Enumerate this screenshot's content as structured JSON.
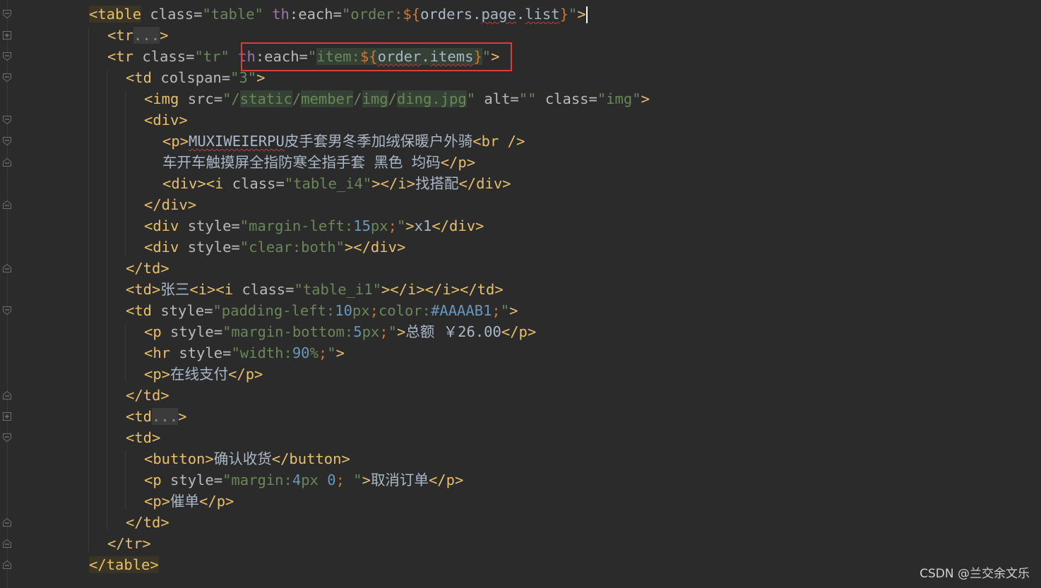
{
  "editor": {
    "lines": [
      {
        "indent": 0,
        "html": "<span class='tag tagbg'>&lt;table</span> <span class='attr'>class=</span><span class='str'>\"table\"</span> <span class='th'>th</span><span class='attr'>:each=</span><span class='str'>\"order:</span><span class='el'>${</span><span class='expr'>orders.<span class='squig'>page</span>.<span class='squig'>list</span></span><span class='el'>}</span><span class='str'>\"</span><span class='tag'>&gt;</span><span class='caret'></span>"
      },
      {
        "indent": 1,
        "html": "<span class='tag'>&lt;tr</span><span class='fold-dots'>...</span><span class='tag'>&gt;</span>"
      },
      {
        "indent": 1,
        "html": "<span class='tag'>&lt;tr</span> <span class='attr'>class=</span><span class='str'>\"tr\"</span> <span class='th'>th</span><span class='attr'>:each=</span><span class='str'>\"</span><span class='str bgstr'>item:</span><span class='el bgstr'>${</span><span class='expr bgstr'><span class='squig'>order</span>.<span class='squig'>items</span></span><span class='el bgstr'>}</span><span class='str'>\"</span><span class='tag'>&gt;</span>"
      },
      {
        "indent": 2,
        "html": "<span class='tag'>&lt;td</span> <span class='attr'>colspan=</span><span class='str'>\"3\"</span><span class='tag'>&gt;</span>"
      },
      {
        "indent": 3,
        "html": "<span class='tag'>&lt;img</span> <span class='attr'>src=</span><span class='str'>\"/<span class='bgstr'>static</span>/<span class='bgstr'>member</span>/<span class='bgstr'>img</span>/<span class='bgstr'>ding.jpg</span>\"</span> <span class='attr'>alt=</span><span class='str'>\"\"</span> <span class='attr'>class=</span><span class='str'>\"img\"</span><span class='tag'>&gt;</span>"
      },
      {
        "indent": 3,
        "html": "<span class='tag'>&lt;div&gt;</span>"
      },
      {
        "indent": 4,
        "html": "<span class='tag'>&lt;p&gt;</span><span class='txt'><span class='squig'>MUXIWEIERPU</span>皮手套男冬季加绒保暖户外骑</span><span class='tag'>&lt;br /&gt;</span>"
      },
      {
        "indent": 4,
        "html": "<span class='txt'>车开车触摸屏全指防寒全指手套 黑色 均码</span><span class='tag'>&lt;/p&gt;</span>"
      },
      {
        "indent": 4,
        "html": "<span class='tag'>&lt;div&gt;&lt;i</span> <span class='attr'>class=</span><span class='str'>\"table_i4\"</span><span class='tag'>&gt;&lt;/i&gt;</span><span class='txt'>找搭配</span><span class='tag'>&lt;/div&gt;</span>"
      },
      {
        "indent": 3,
        "html": "<span class='tag'>&lt;/div&gt;</span>"
      },
      {
        "indent": 3,
        "html": "<span class='tag'>&lt;div</span> <span class='attr'>style=</span><span class='str'>\"margin-left:</span><span class='num'>15</span><span class='str'>px</span><span class='punc'>;</span><span class='str'>\"</span><span class='tag'>&gt;</span><span class='txt'>x1</span><span class='tag'>&lt;/div&gt;</span>"
      },
      {
        "indent": 3,
        "html": "<span class='tag'>&lt;div</span> <span class='attr'>style=</span><span class='str'>\"clear:both\"</span><span class='tag'>&gt;&lt;/div&gt;</span>"
      },
      {
        "indent": 2,
        "html": "<span class='tag'>&lt;/td&gt;</span>"
      },
      {
        "indent": 2,
        "html": "<span class='tag'>&lt;td&gt;</span><span class='txt'>张三</span><span class='tag'>&lt;i&gt;&lt;i</span> <span class='attr'>class=</span><span class='str'>\"table_i1\"</span><span class='tag'>&gt;&lt;/i&gt;&lt;/i&gt;&lt;/td&gt;</span>"
      },
      {
        "indent": 2,
        "html": "<span class='tag'>&lt;td</span> <span class='attr'>style=</span><span class='str'>\"padding-left:</span><span class='num'>10</span><span class='str'>px</span><span class='punc'>;</span><span class='str'>color:</span><span class='num'>#AAAAB1</span><span class='punc'>;</span><span class='str'>\"</span><span class='tag'>&gt;</span>"
      },
      {
        "indent": 3,
        "html": "<span class='tag'>&lt;p</span> <span class='attr'>style=</span><span class='str'>\"margin-bottom:</span><span class='num'>5</span><span class='str'>px</span><span class='punc'>;</span><span class='str'>\"</span><span class='tag'>&gt;</span><span class='txt'>总额 ￥26.00</span><span class='tag'>&lt;/p&gt;</span>"
      },
      {
        "indent": 3,
        "html": "<span class='tag'>&lt;hr</span> <span class='attr'>style=</span><span class='str'>\"width:</span><span class='num'>90</span><span class='str'>%</span><span class='punc'>;</span><span class='str'>\"</span><span class='tag'>&gt;</span>"
      },
      {
        "indent": 3,
        "html": "<span class='tag'>&lt;p&gt;</span><span class='txt'>在线支付</span><span class='tag'>&lt;/p&gt;</span>"
      },
      {
        "indent": 2,
        "html": "<span class='tag'>&lt;/td&gt;</span>"
      },
      {
        "indent": 2,
        "html": "<span class='tag'>&lt;td</span><span class='fold-dots'>...</span><span class='tag'>&gt;</span>"
      },
      {
        "indent": 2,
        "html": "<span class='tag'>&lt;td&gt;</span>"
      },
      {
        "indent": 3,
        "html": "<span class='tag'>&lt;button&gt;</span><span class='txt'>确认收货</span><span class='tag'>&lt;/button&gt;</span>"
      },
      {
        "indent": 3,
        "html": "<span class='tag'>&lt;p</span> <span class='attr'>style=</span><span class='str'>\"margin:</span><span class='num'>4</span><span class='str'>px </span><span class='num'>0</span><span class='punc'>;</span><span class='str'> \"</span><span class='tag'>&gt;</span><span class='txt'>取消订单</span><span class='tag'>&lt;/p&gt;</span>"
      },
      {
        "indent": 3,
        "html": "<span class='tag'>&lt;p&gt;</span><span class='txt'>催单</span><span class='tag'>&lt;/p&gt;</span>"
      },
      {
        "indent": 2,
        "html": "<span class='tag'>&lt;/td&gt;</span>"
      },
      {
        "indent": 1,
        "html": "<span class='tag'>&lt;/tr&gt;</span>"
      },
      {
        "indent": 0,
        "html": "<span class='tag tagbg'>&lt;/table&gt;</span>"
      }
    ],
    "folds": [
      {
        "line": 0,
        "kind": "open"
      },
      {
        "line": 1,
        "kind": "plus"
      },
      {
        "line": 2,
        "kind": "open"
      },
      {
        "line": 3,
        "kind": "open"
      },
      {
        "line": 5,
        "kind": "open"
      },
      {
        "line": 6,
        "kind": "open"
      },
      {
        "line": 7,
        "kind": "close"
      },
      {
        "line": 9,
        "kind": "close"
      },
      {
        "line": 12,
        "kind": "close"
      },
      {
        "line": 14,
        "kind": "open"
      },
      {
        "line": 18,
        "kind": "close"
      },
      {
        "line": 19,
        "kind": "plus"
      },
      {
        "line": 20,
        "kind": "open"
      },
      {
        "line": 24,
        "kind": "close"
      },
      {
        "line": 25,
        "kind": "close"
      },
      {
        "line": 26,
        "kind": "close"
      }
    ]
  },
  "watermark": "CSDN @兰交余文乐"
}
